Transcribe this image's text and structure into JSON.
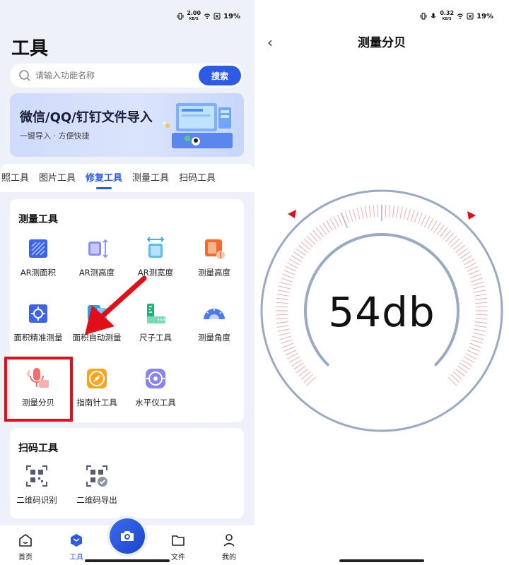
{
  "left": {
    "status": {
      "speed": "2.00",
      "speed_unit": "KB/S",
      "battery": "19%"
    },
    "title": "工具",
    "search": {
      "placeholder": "请输入功能名称",
      "button": "搜索"
    },
    "banner": {
      "title": "微信/QQ/钉钉文件导入",
      "subtitle": "一键导入 · 方便快捷"
    },
    "tabs": [
      {
        "label": "照工具",
        "active": false
      },
      {
        "label": "图片工具",
        "active": false
      },
      {
        "label": "修复工具",
        "active": true
      },
      {
        "label": "测量工具",
        "active": false
      },
      {
        "label": "扫码工具",
        "active": false
      }
    ],
    "measure_section": {
      "title": "测量工具",
      "tools": [
        {
          "label": "AR测面积",
          "icon": "ar-area-icon"
        },
        {
          "label": "AR测高度",
          "icon": "ar-height-icon"
        },
        {
          "label": "AR测宽度",
          "icon": "ar-width-icon"
        },
        {
          "label": "测量高度",
          "icon": "measure-height-icon"
        },
        {
          "label": "面积精准测量",
          "icon": "precise-area-icon"
        },
        {
          "label": "面积自动测量",
          "icon": "auto-area-icon"
        },
        {
          "label": "尺子工具",
          "icon": "ruler-icon"
        },
        {
          "label": "测量角度",
          "icon": "protractor-icon"
        },
        {
          "label": "测量分贝",
          "icon": "decibel-mic-icon"
        },
        {
          "label": "指南针工具",
          "icon": "compass-icon"
        },
        {
          "label": "水平仪工具",
          "icon": "level-icon"
        }
      ]
    },
    "scan_section": {
      "title": "扫码工具",
      "tools": [
        {
          "label": "二维码识别",
          "icon": "qr-scan-icon"
        },
        {
          "label": "二维码导出",
          "icon": "qr-export-icon"
        }
      ]
    },
    "bottom_nav": [
      {
        "label": "首页",
        "icon": "home-icon",
        "active": false
      },
      {
        "label": "工具",
        "icon": "tools-icon",
        "active": true
      },
      {
        "label": "文件",
        "icon": "folder-icon",
        "active": false
      },
      {
        "label": "我的",
        "icon": "profile-icon",
        "active": false
      }
    ],
    "highlight_color": "#e0101a",
    "accent": "#2e5be6"
  },
  "right": {
    "status": {
      "speed": "0.32",
      "speed_unit": "KB/S",
      "battery": "19%"
    },
    "title": "测量分贝",
    "reading": "54db",
    "gauge_level": 0.0,
    "colors": {
      "ring": "#9aa9c4",
      "ticks": "#e8a7a7",
      "marker": "#e0101a"
    }
  }
}
